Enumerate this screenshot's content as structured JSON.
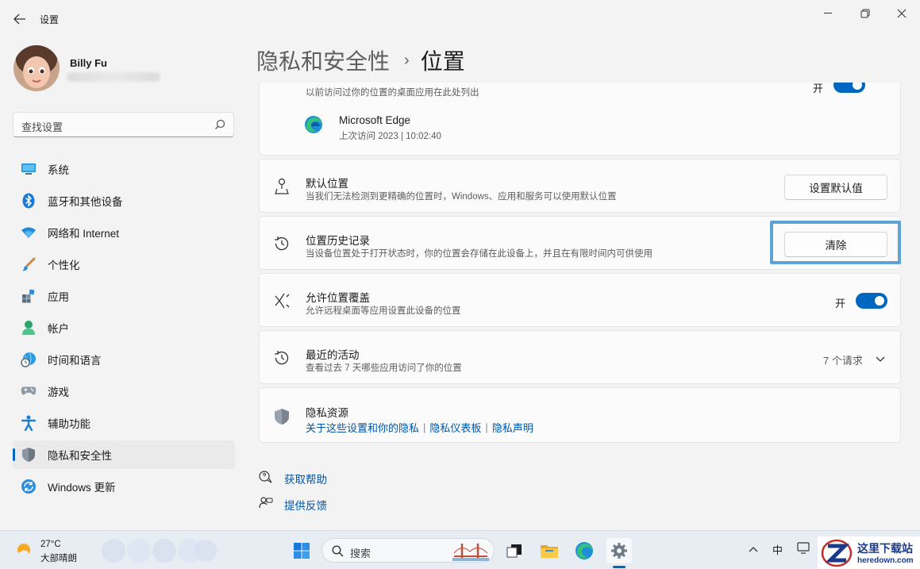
{
  "window": {
    "title": "设置",
    "back_icon": "back-arrow-icon",
    "controls": [
      "minimize-icon",
      "maximize-icon",
      "close-icon"
    ]
  },
  "profile": {
    "name": "Billy Fu"
  },
  "search": {
    "placeholder": "查找设置"
  },
  "nav": {
    "items": [
      {
        "label": "系统",
        "icon": "monitor-icon"
      },
      {
        "label": "蓝牙和其他设备",
        "icon": "bluetooth-icon"
      },
      {
        "label": "网络和 Internet",
        "icon": "wifi-icon"
      },
      {
        "label": "个性化",
        "icon": "brush-icon"
      },
      {
        "label": "应用",
        "icon": "apps-icon"
      },
      {
        "label": "帐户",
        "icon": "account-icon"
      },
      {
        "label": "时间和语言",
        "icon": "globe-clock-icon"
      },
      {
        "label": "游戏",
        "icon": "gamepad-icon"
      },
      {
        "label": "辅助功能",
        "icon": "accessibility-icon"
      },
      {
        "label": "隐私和安全性",
        "icon": "shield-icon",
        "active": true
      },
      {
        "label": "Windows 更新",
        "icon": "update-icon"
      }
    ]
  },
  "header": {
    "parent": "隐私和安全性",
    "current": "位置"
  },
  "cards": {
    "recent_apps": {
      "desc": "以前访问过你的位置的桌面应用在此处列出",
      "toggle_label": "开",
      "app_name": "Microsoft Edge",
      "app_last_access": "上次访问 2023  |  10:02:40"
    },
    "default_location": {
      "title": "默认位置",
      "desc": "当我们无法检测到更精确的位置时，Windows、应用和服务可以使用默认位置",
      "button": "设置默认值"
    },
    "location_history": {
      "title": "位置历史记录",
      "desc": "当设备位置处于打开状态时，你的位置会存储在此设备上，并且在有限时间内可供使用",
      "button": "清除"
    },
    "override": {
      "title": "允许位置覆盖",
      "desc": "允许远程桌面等应用设置此设备的位置",
      "toggle_label": "开",
      "toggle_on": true
    },
    "recent_activity": {
      "title": "最近的活动",
      "desc": "查看过去 7 天哪些应用访问了你的位置",
      "count": "7 个请求"
    },
    "privacy_resources": {
      "title": "隐私资源",
      "links": [
        "关于这些设置和你的隐私",
        "隐私仪表板",
        "隐私声明"
      ]
    }
  },
  "help": {
    "get_help": "获取帮助",
    "feedback": "提供反馈"
  },
  "taskbar": {
    "temperature": "27°C",
    "weather": "大部晴朗",
    "search_label": "搜索",
    "ime": "中",
    "accent": "#0067c0"
  },
  "watermark": {
    "name": "这里下载站",
    "url": "heredown.com"
  }
}
